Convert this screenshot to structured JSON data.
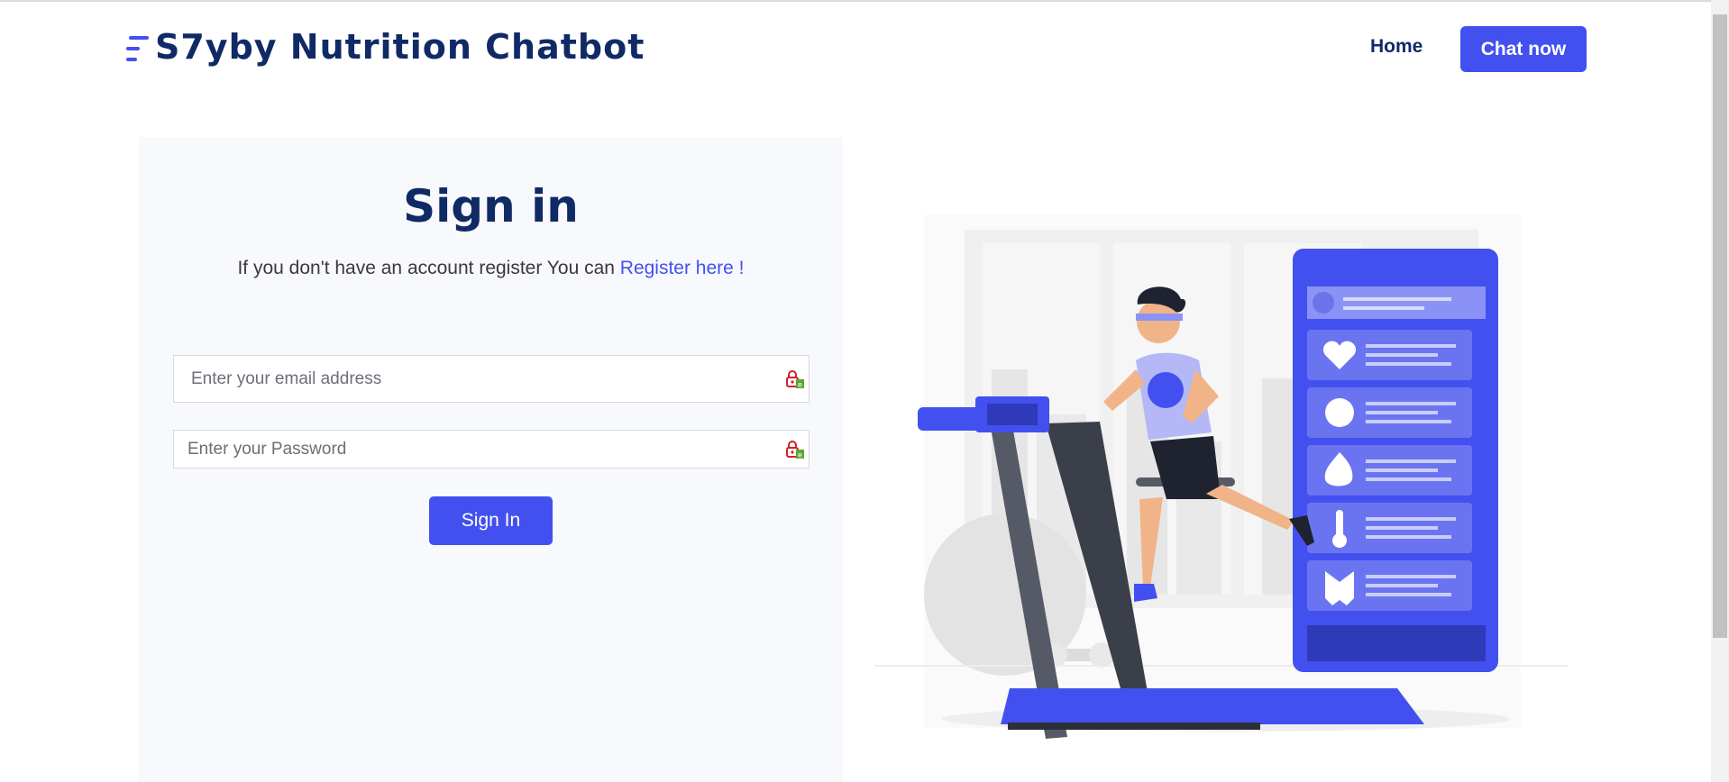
{
  "header": {
    "brand": "S7yby Nutrition Chatbot",
    "nav_home": "Home",
    "nav_chat": "Chat now"
  },
  "signin": {
    "title": "Sign in",
    "subtitle_prefix": "If you don't have an account register You can ",
    "register_link": "Register here !",
    "email_placeholder": "Enter your email address",
    "password_placeholder": "Enter your Password",
    "button": "Sign In"
  },
  "colors": {
    "accent": "#4350f0",
    "heading": "#102a66",
    "panel": "#f8f9fc"
  },
  "icons": {
    "brand": "menu-lines-icon",
    "field_addon": "password-manager-lock-icon",
    "illustration_cards": [
      "heart-rate-icon",
      "timer-icon",
      "flame-icon",
      "thermometer-icon",
      "shoe-icon"
    ]
  }
}
